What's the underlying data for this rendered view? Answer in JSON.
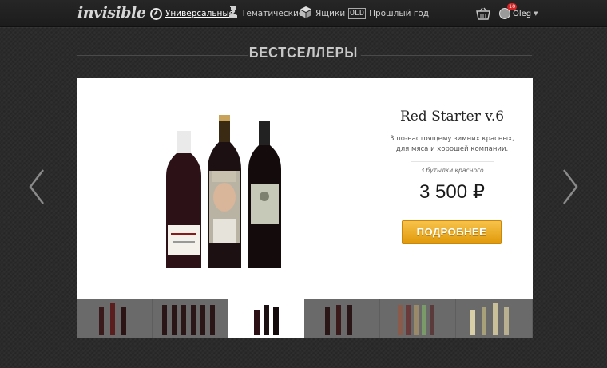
{
  "brand": {
    "logo_text": "invisible"
  },
  "nav": {
    "items": [
      {
        "label": "Универсальные",
        "icon": "compass-icon",
        "active": true
      },
      {
        "label": "Тематические",
        "icon": "person-icon",
        "active": false
      },
      {
        "label": "Ящики",
        "icon": "box-icon",
        "active": false
      },
      {
        "label": "Прошлый год",
        "icon": "old-icon",
        "icon_text": "OLD",
        "active": false
      }
    ]
  },
  "user": {
    "name": "Oleg",
    "notifications": "10"
  },
  "section": {
    "title": "БЕСТСЕЛЛЕРЫ"
  },
  "slide": {
    "title": "Red Starter v.6",
    "description": "3 по-настоящему зимних красных, для мяса и хорошей компании.",
    "subtitle": "3 бутылки красного",
    "price": "3 500 ₽",
    "button_label": "ПОДРОБНЕЕ"
  },
  "thumbnails": [
    {
      "name": "set-1",
      "active": false
    },
    {
      "name": "set-2",
      "active": false
    },
    {
      "name": "set-3",
      "active": true
    },
    {
      "name": "set-4",
      "active": false
    },
    {
      "name": "set-5",
      "active": false
    },
    {
      "name": "set-6",
      "active": false
    }
  ],
  "colors": {
    "accent_button": "#e8a514",
    "background": "#2b2b2b",
    "topbar": "#1f1f1f",
    "notification_badge": "#d62222"
  }
}
